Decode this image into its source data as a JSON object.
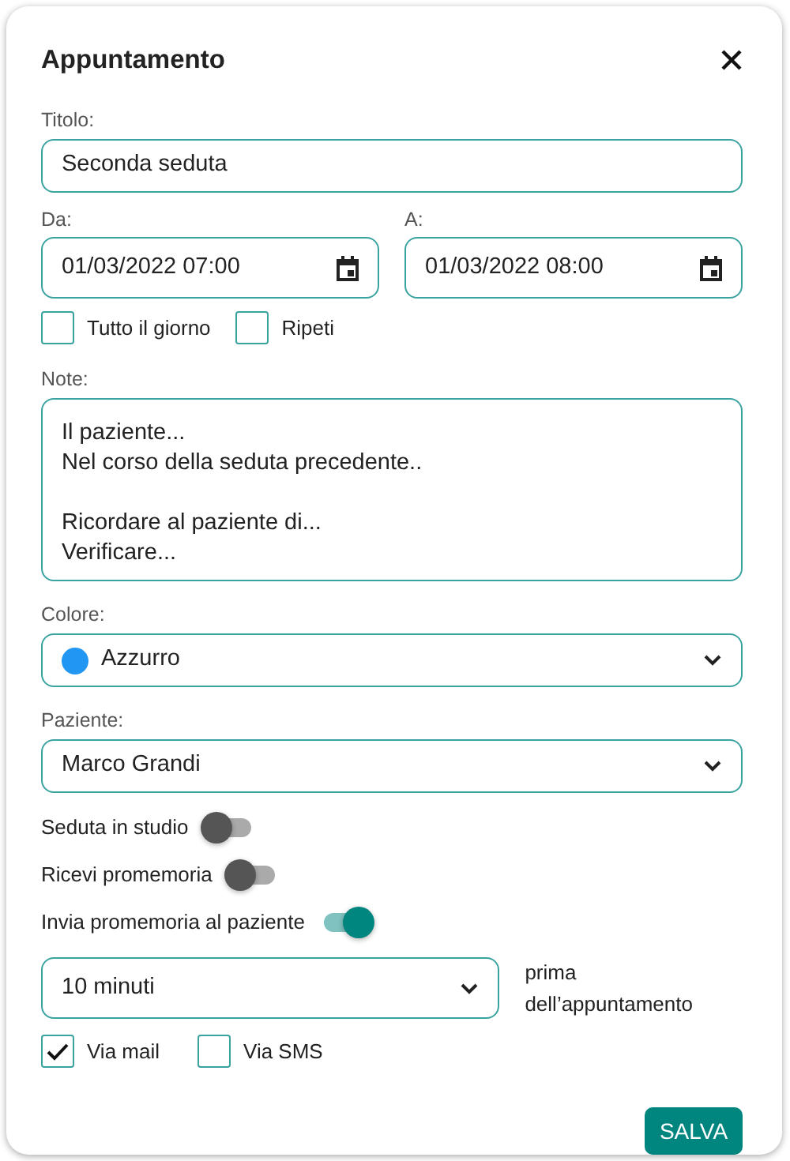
{
  "dialog": {
    "title": "Appuntamento"
  },
  "title_field": {
    "label": "Titolo:",
    "value": "Seconda seduta"
  },
  "dates": [
    {
      "label": "Da:",
      "value": "01/03/2022 07:00"
    },
    {
      "label": "A:",
      "value": "01/03/2022 08:00"
    }
  ],
  "options": [
    {
      "label": "Tutto il giorno",
      "checked": false
    },
    {
      "label": "Ripeti",
      "checked": false
    }
  ],
  "notes": {
    "label": "Note:",
    "value": "Il paziente...\nNel corso della seduta precedente..\n\nRicordare al paziente di...\nVerificare..."
  },
  "color_field": {
    "label": "Colore:",
    "value": "Azzurro",
    "color": "#2196f3"
  },
  "patient_field": {
    "label": "Paziente:",
    "value": "Marco Grandi"
  },
  "toggles": [
    {
      "label": "Seduta in studio",
      "on": false
    },
    {
      "label": "Ricevi promemoria",
      "on": false
    },
    {
      "label": "Invia promemoria al paziente",
      "on": true
    }
  ],
  "reminder": {
    "value": "10 minuti",
    "suffix": "prima dell’appuntamento"
  },
  "channels": [
    {
      "label": "Via mail",
      "checked": true
    },
    {
      "label": "Via SMS",
      "checked": false
    }
  ],
  "save_button": "SALVA"
}
